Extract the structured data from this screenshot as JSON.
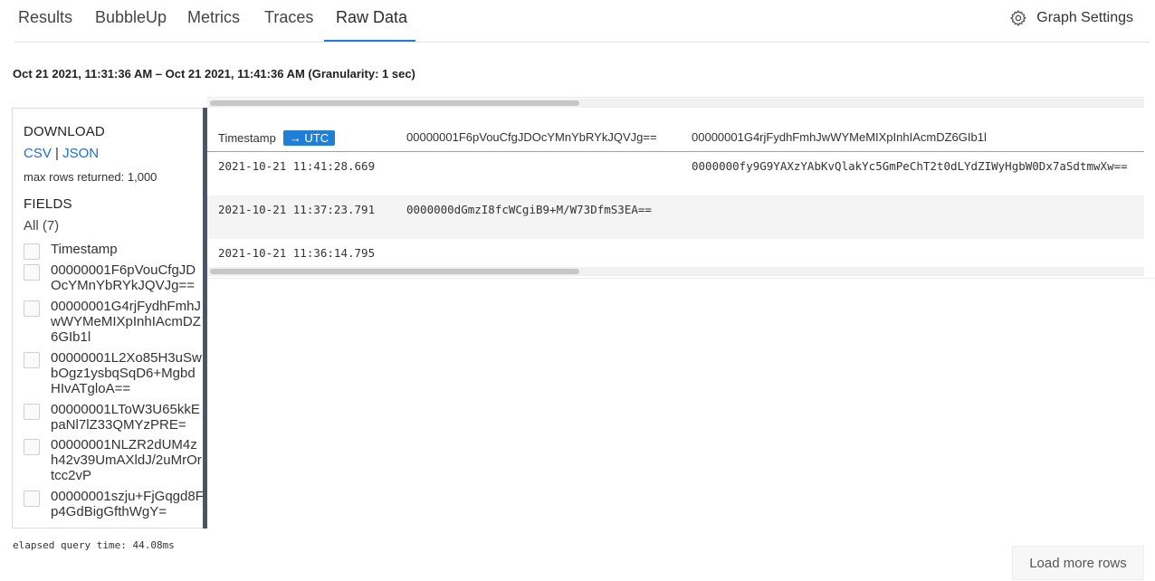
{
  "tabs": [
    {
      "label": "Results"
    },
    {
      "label": "BubbleUp"
    },
    {
      "label": "Metrics"
    },
    {
      "label": "Traces"
    },
    {
      "label": "Raw Data",
      "active": true
    }
  ],
  "graph_settings": {
    "label": "Graph Settings",
    "icon": "gear-icon"
  },
  "time_range": "Oct 21 2021, 11:31:36 AM – Oct 21 2021, 11:41:36 AM (Granularity: 1 sec)",
  "download": {
    "title": "DOWNLOAD",
    "csv": "CSV",
    "separator": "|",
    "json": "JSON",
    "max_rows": "max rows returned: 1,000"
  },
  "fields": {
    "title": "FIELDS",
    "all_label": "All (7)",
    "items": [
      {
        "label": "Timestamp",
        "checked": false
      },
      {
        "label": "00000001F6pVouCfgJDOcYMnYbRYkJQVJg==",
        "checked": false
      },
      {
        "label": "00000001G4rjFydhFmhJwWYMeMIXpInhIAcmDZ6GIb1l",
        "checked": false
      },
      {
        "label": "00000001L2Xo85H3uSwbOgz1ysbqSqD6+MgbdHIvATgloA==",
        "checked": false
      },
      {
        "label": "00000001LToW3U65kkEpaNl7lZ33QMYzPRE=",
        "checked": false
      },
      {
        "label": "00000001NLZR2dUM4zh42v39UmAXldJ/2uMrOrtcc2vP",
        "checked": false
      },
      {
        "label": "00000001szju+FjGqgd8Fp4GdBigGfthWgY=",
        "checked": false
      }
    ]
  },
  "table": {
    "columns": [
      "Timestamp",
      "00000001F6pVouCfgJDOcYMnYbRYkJQVJg==",
      "00000001G4rjFydhFmhJwWYMeMIXpInhIAcmDZ6GIb1l"
    ],
    "utc_badge": "→ UTC",
    "rows": [
      [
        "2021-10-21 11:41:28.669",
        "",
        "0000000fy9G9YAXzYAbKvQlakYc5GmPeChT2t0dLYdZIWyHgbW0Dx7aSdtmwXw=="
      ],
      [
        "2021-10-21 11:37:23.791",
        "0000000dGmzI8fcWCgiB9+M/W73DfmS3EA==",
        ""
      ],
      [
        "2021-10-21 11:36:14.795",
        "",
        ""
      ]
    ]
  },
  "footer": {
    "elapsed": "elapsed query time: 44.08ms",
    "load_more": "Load more rows"
  },
  "colors": {
    "accent": "#1f7fd6",
    "link": "#1f6fc5",
    "panel_bar": "#4b5563"
  }
}
